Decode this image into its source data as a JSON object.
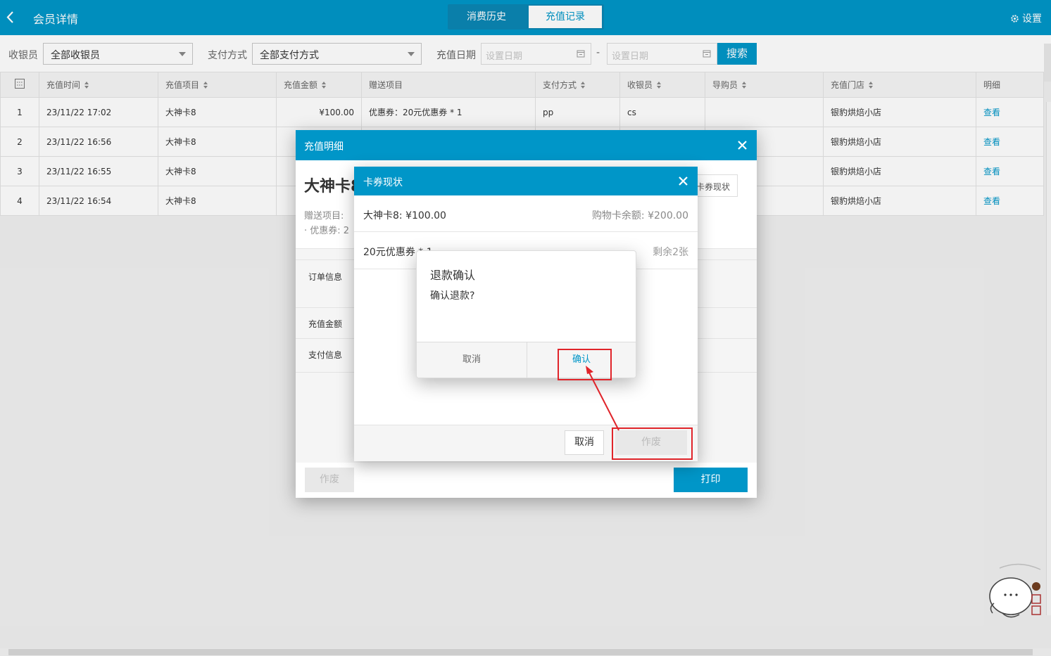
{
  "header": {
    "title": "会员详情",
    "tabs": [
      {
        "label": "消费历史",
        "active": false
      },
      {
        "label": "充值记录",
        "active": true
      }
    ],
    "settings_label": "设置"
  },
  "filters": {
    "cashier_label": "收银员",
    "cashier_value": "全部收银员",
    "payment_label": "支付方式",
    "payment_value": "全部支付方式",
    "date_label": "充值日期",
    "date_start_placeholder": "设置日期",
    "date_end_placeholder": "设置日期",
    "date_separator": "-",
    "search_label": "搜索"
  },
  "table": {
    "columns": [
      "充值时间",
      "充值项目",
      "充值金额",
      "赠送项目",
      "支付方式",
      "收银员",
      "导购员",
      "充值门店",
      "明细"
    ],
    "rows": [
      {
        "index": "1",
        "time": "23/11/22 17:02",
        "item": "大神卡8",
        "amount": "¥100.00",
        "gift": "优惠券：20元优惠券 * 1",
        "payment": "pp",
        "cashier": "cs",
        "guide": "",
        "store": "银豹烘焙小店",
        "detail": "查看"
      },
      {
        "index": "2",
        "time": "23/11/22 16:56",
        "item": "大神卡8",
        "amount": "",
        "gift": "",
        "payment": "",
        "cashier": "",
        "guide": "",
        "store": "银豹烘焙小店",
        "detail": "查看"
      },
      {
        "index": "3",
        "time": "23/11/22 16:55",
        "item": "大神卡8",
        "amount": "",
        "gift": "",
        "payment": "",
        "cashier": "",
        "guide": "",
        "store": "银豹烘焙小店",
        "detail": "查看"
      },
      {
        "index": "4",
        "time": "23/11/22 16:54",
        "item": "大神卡8",
        "amount": "",
        "gift": "",
        "payment": "",
        "cashier": "",
        "guide": "",
        "store": "银豹烘焙小店",
        "detail": "查看"
      }
    ]
  },
  "recharge_detail_dialog": {
    "title": "充值明细",
    "card_name": "大神卡8",
    "gift_label": "赠送项目:",
    "gift_coupon": "· 优惠券: 2",
    "card_status_button": "卡券现状",
    "rows": [
      "订单信息",
      "充值金额",
      "支付信息"
    ],
    "void_label": "作废",
    "print_label": "打印"
  },
  "card_status_dialog": {
    "title": "卡券现状",
    "card_line": "大神卡8:  ¥100.00",
    "balance_line": "购物卡余额: ¥200.00",
    "coupon_line": "20元优惠券 * 1",
    "remaining": "剩余2张",
    "cancel_label": "取消",
    "void_label": "作废"
  },
  "refund_confirm_dialog": {
    "title": "退款确认",
    "message": "确认退款?",
    "cancel_label": "取消",
    "confirm_label": "确认"
  },
  "colors": {
    "primary": "#0096c8",
    "highlight": "#e0242a"
  }
}
